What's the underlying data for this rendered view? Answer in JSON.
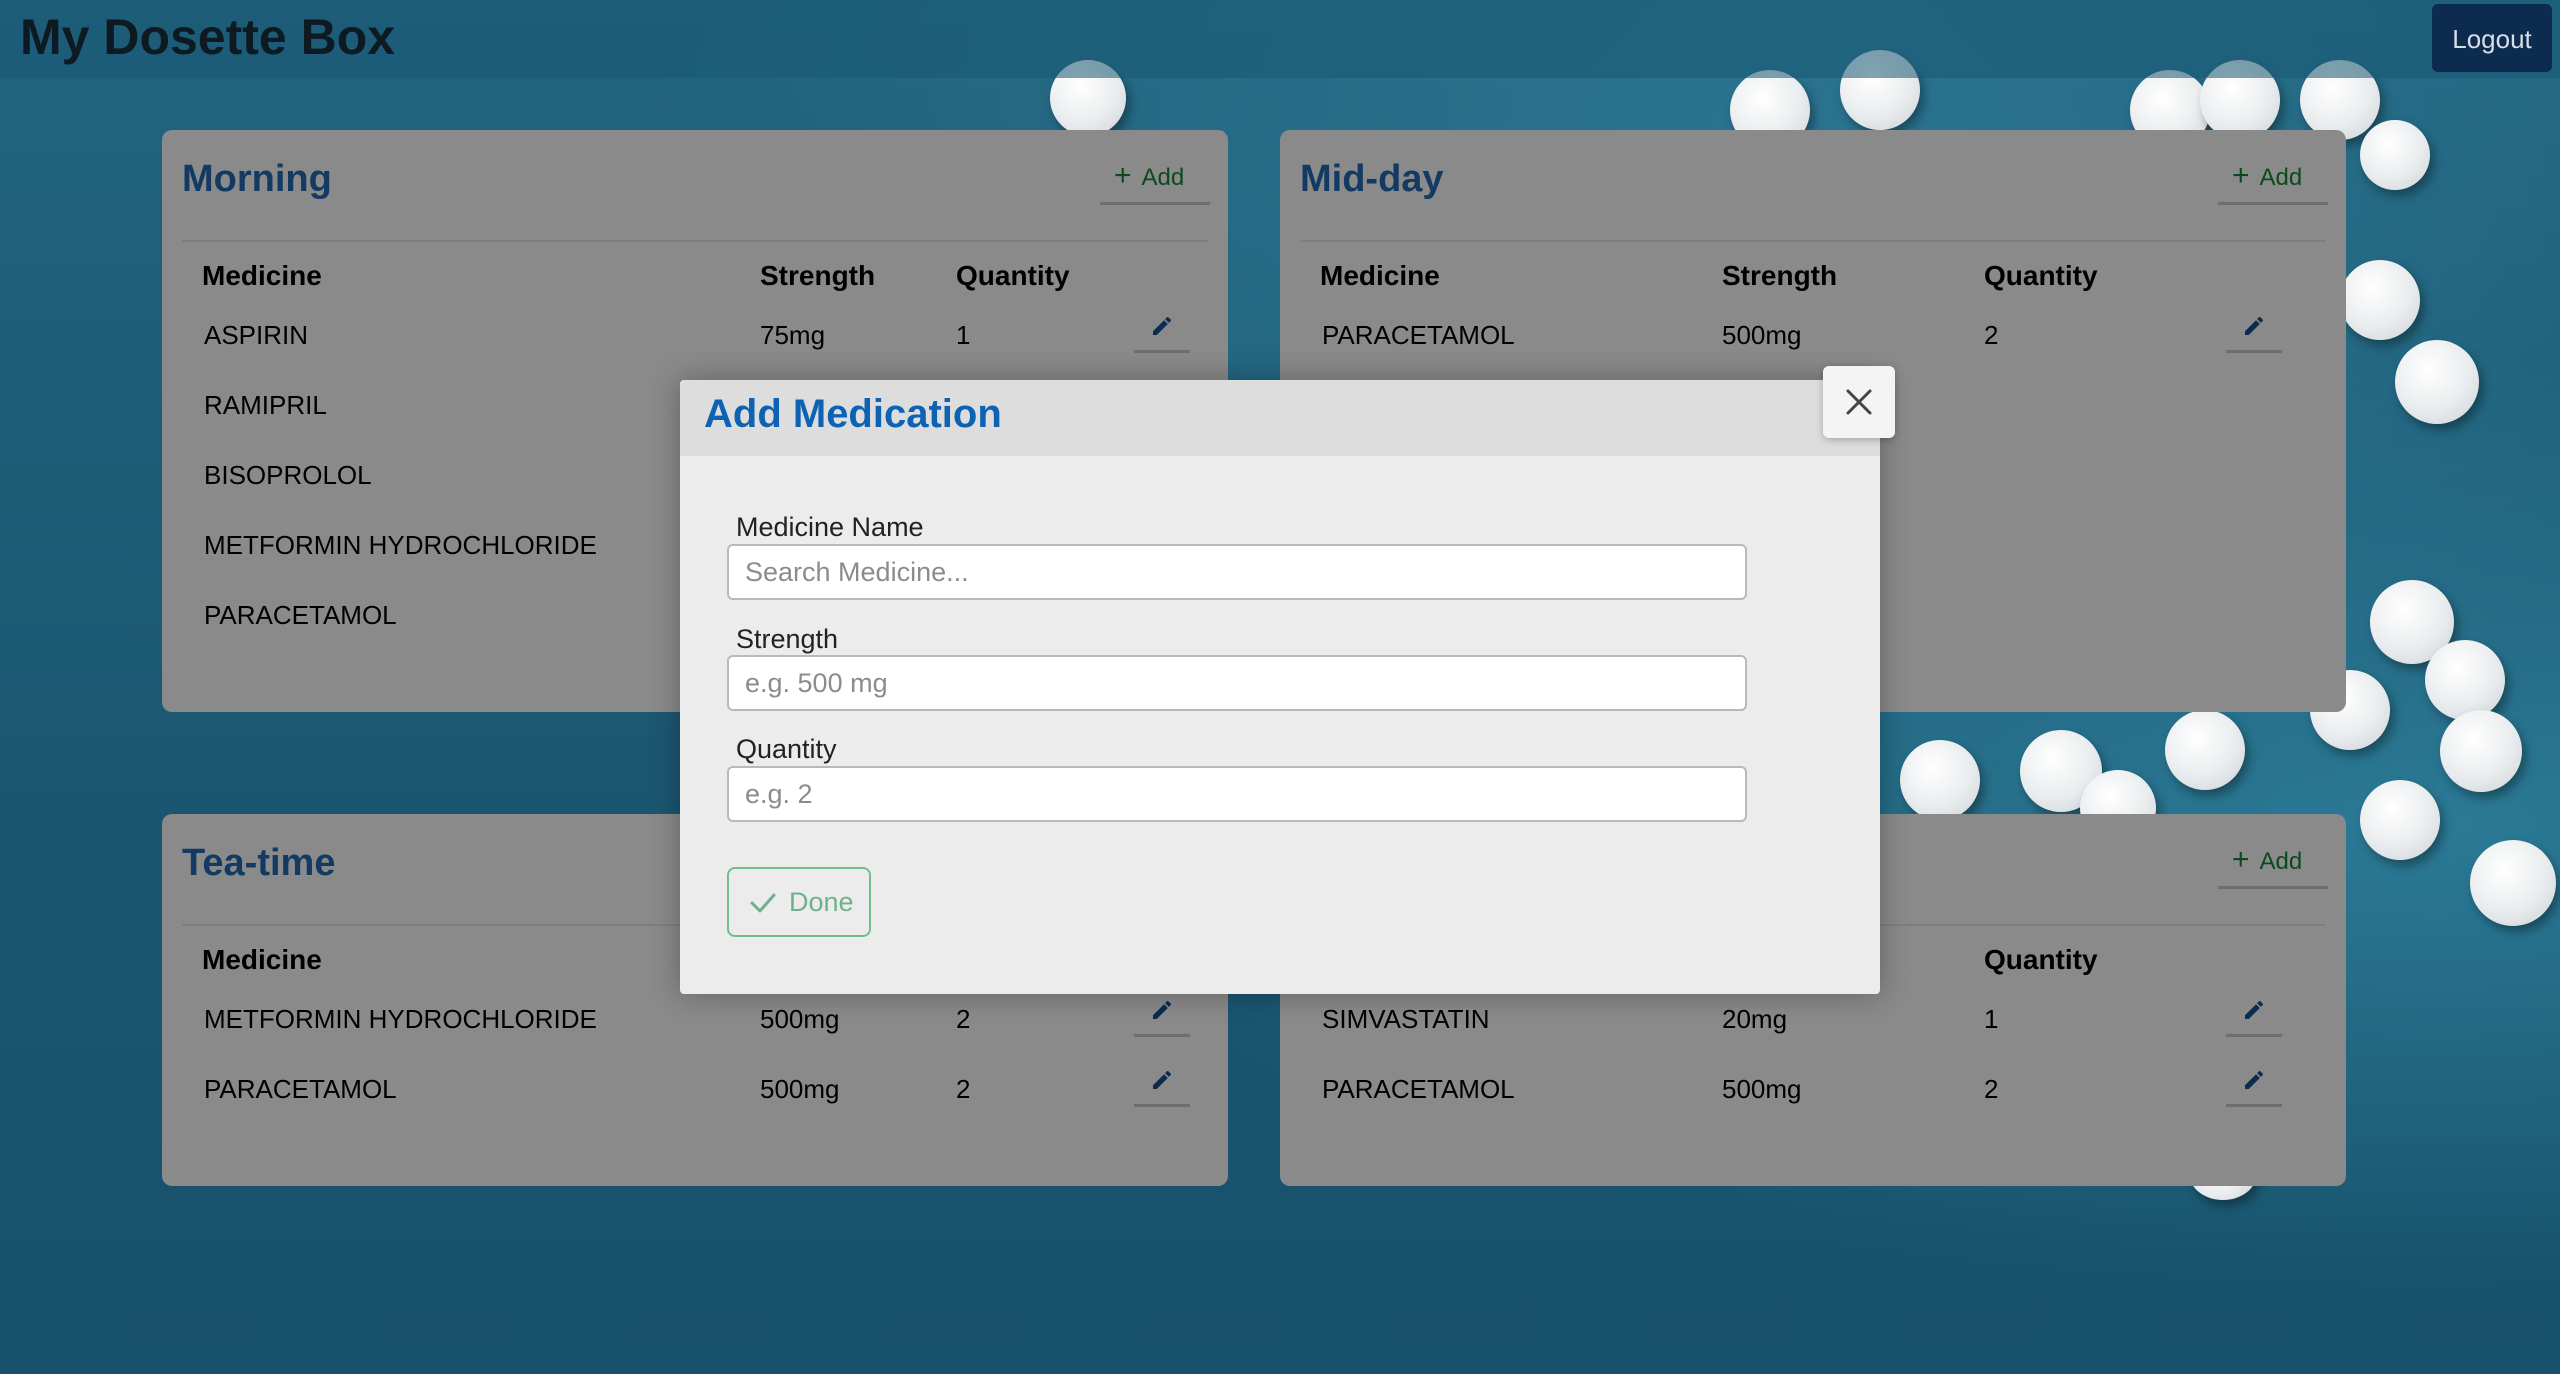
{
  "app": {
    "title": "My Dosette Box",
    "logout_label": "Logout"
  },
  "add_label": "Add",
  "columns": {
    "medicine": "Medicine",
    "strength": "Strength",
    "quantity": "Quantity"
  },
  "cards": {
    "morning": {
      "title": "Morning",
      "rows": [
        {
          "name": "ASPIRIN",
          "strength": "75mg",
          "quantity": "1"
        },
        {
          "name": "RAMIPRIL",
          "strength": "",
          "quantity": ""
        },
        {
          "name": "BISOPROLOL",
          "strength": "",
          "quantity": ""
        },
        {
          "name": "METFORMIN HYDROCHLORIDE",
          "strength": "",
          "quantity": ""
        },
        {
          "name": "PARACETAMOL",
          "strength": "",
          "quantity": ""
        }
      ]
    },
    "midday": {
      "title": "Mid-day",
      "rows": [
        {
          "name": "PARACETAMOL",
          "strength": "500mg",
          "quantity": "2"
        }
      ]
    },
    "teatime": {
      "title": "Tea-time",
      "rows": [
        {
          "name": "METFORMIN HYDROCHLORIDE",
          "strength": "500mg",
          "quantity": "2"
        },
        {
          "name": "PARACETAMOL",
          "strength": "500mg",
          "quantity": "2"
        }
      ]
    },
    "bedtime": {
      "title": "",
      "rows": [
        {
          "name": "SIMVASTATIN",
          "strength": "20mg",
          "quantity": "1"
        },
        {
          "name": "PARACETAMOL",
          "strength": "500mg",
          "quantity": "2"
        }
      ]
    }
  },
  "modal": {
    "title": "Add Medication",
    "fields": {
      "name": {
        "label": "Medicine Name",
        "placeholder": "Search Medicine...",
        "value": ""
      },
      "strength": {
        "label": "Strength",
        "placeholder": "e.g. 500 mg",
        "value": ""
      },
      "quantity": {
        "label": "Quantity",
        "placeholder": "e.g. 2",
        "value": ""
      }
    },
    "done_label": "Done"
  },
  "colors": {
    "accent": "#0d62b4",
    "card_title": "#123a63",
    "done": "#6fbf8c",
    "logout_bg": "#0c2b4e"
  }
}
